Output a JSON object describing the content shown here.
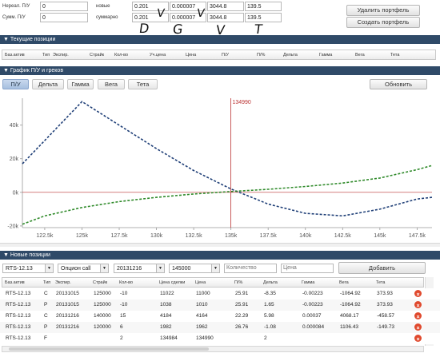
{
  "summary": {
    "rows": [
      {
        "label": "Нереал. П/У",
        "value": "0"
      },
      {
        "label": "Сумм. П/У",
        "value": "0"
      }
    ],
    "greeks_rows": [
      {
        "label": "новые",
        "delta": "0.201",
        "gamma": "0.000007",
        "vega": "3044.8",
        "theta": "139.5"
      },
      {
        "label": "суммарно",
        "delta": "0.201",
        "gamma": "0.000007",
        "vega": "3044.8",
        "theta": "139.5"
      }
    ],
    "handwritten": [
      "D",
      "G",
      "V",
      "T"
    ],
    "check_marks": [
      "V",
      "V"
    ]
  },
  "portfolio_buttons": {
    "delete": "Удалить портфель",
    "create": "Создать портфель"
  },
  "current_positions": {
    "title": "▼ Текущие позиции",
    "columns": [
      "Баз.актив",
      "Тип",
      "Экспир.",
      "Страйк",
      "Кол-во",
      "Уч.цена",
      "Цена",
      "П/У",
      "П/%",
      "Дельта",
      "Гамма",
      "Вега",
      "Тета"
    ]
  },
  "chart_panel": {
    "title": "▼ График П/У и греков",
    "tabs": [
      "П/У",
      "Дельта",
      "Гамма",
      "Вега",
      "Тета"
    ],
    "active_tab": "П/У",
    "refresh_label": "Обновить"
  },
  "chart_data": {
    "type": "line",
    "x_ticks": [
      "122.5k",
      "125k",
      "127.5k",
      "130k",
      "132.5k",
      "135k",
      "137.5k",
      "140k",
      "142.5k",
      "145k",
      "147.5k"
    ],
    "y_ticks": [
      "40k",
      "20k",
      "0k",
      "-20k"
    ],
    "xlim": [
      121000,
      148500
    ],
    "ylim": [
      -21000,
      56000
    ],
    "marker_x": 134990,
    "marker_label": "134990",
    "series": [
      {
        "color": "#1f3f77",
        "x": [
          121000,
          125000,
          127500,
          130000,
          132500,
          135000,
          137500,
          140000,
          142500,
          145000,
          147500,
          148500
        ],
        "y": [
          17000,
          54000,
          40000,
          26000,
          13000,
          2000,
          -7000,
          -12500,
          -14000,
          -10000,
          -4000,
          -3000
        ]
      },
      {
        "color": "#2f8a2a",
        "x": [
          121000,
          122500,
          125000,
          127500,
          130000,
          132500,
          135000,
          137500,
          140000,
          142500,
          145000,
          147500,
          148500
        ],
        "y": [
          -19000,
          -14000,
          -9000,
          -5500,
          -3000,
          -1000,
          500,
          1800,
          3500,
          5500,
          8500,
          13500,
          16000
        ]
      }
    ]
  },
  "new_positions": {
    "title": "▼ Новые позиции",
    "filters": {
      "asset": "RTS-12.13",
      "type": "Опцион call",
      "expiry": "20131216",
      "strike": "145000",
      "qty_placeholder": "Количество",
      "price_placeholder": "Цена",
      "add_label": "Добавить"
    },
    "columns": [
      "Баз.актив",
      "Тип",
      "Экспир.",
      "Страйк",
      "Кол-во",
      "Цена сделки",
      "Цена",
      "П/%",
      "Дельта",
      "Гамма",
      "Вега",
      "Тета"
    ],
    "rows": [
      [
        "RTS-12.13",
        "C",
        "20131015",
        "125000",
        "-10",
        "11022",
        "11000",
        "25.91",
        "-8.35",
        "-0.00223",
        "-1064.92",
        "373.93"
      ],
      [
        "RTS-12.13",
        "P",
        "20131015",
        "125000",
        "-10",
        "1038",
        "1010",
        "25.91",
        "1.65",
        "-0.00223",
        "-1064.92",
        "373.93"
      ],
      [
        "RTS-12.13",
        "C",
        "20131216",
        "140000",
        "15",
        "4184",
        "4164",
        "22.29",
        "5.98",
        "0.00037",
        "4068.17",
        "-458.57"
      ],
      [
        "RTS-12.13",
        "P",
        "20131216",
        "120000",
        "6",
        "1982",
        "1962",
        "26.76",
        "-1.08",
        "0.000084",
        "1106.43",
        "-149.73"
      ],
      [
        "RTS-12.13",
        "F",
        "",
        "",
        "2",
        "134984",
        "134990",
        "",
        "2",
        "",
        "",
        ""
      ]
    ]
  }
}
